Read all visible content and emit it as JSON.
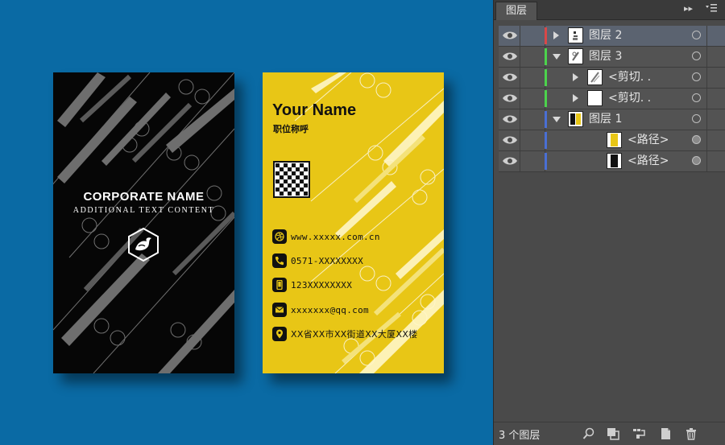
{
  "canvas": {
    "black_card": {
      "corporate_name": "CORPORATE NAME",
      "additional_text": "ADDITIONAL TEXT CONTENT"
    },
    "yellow_card": {
      "name": "Your Name",
      "position_title": "职位称呼",
      "website": "www.xxxxx.com.cn",
      "phone": "0571-XXXXXXXX",
      "mobile": "123XXXXXXXX",
      "email": "xxxxxxx@qq.com",
      "address": "XX省XX市XX街道XX大厦XX楼"
    },
    "colors": {
      "background": "#0a6aa4",
      "black_card": "#060606",
      "yellow_card": "#e8c616"
    }
  },
  "layers_panel": {
    "tab_label": "图层",
    "menu_glyph": "▸▸",
    "layers": [
      {
        "name": "图层 2",
        "color": "#d94848",
        "expand": "collapsed",
        "indent": 0,
        "thumb": "layer2",
        "target": "empty"
      },
      {
        "name": "图层 3",
        "color": "#4cd34c",
        "expand": "expanded",
        "indent": 0,
        "thumb": "layer3",
        "target": "empty"
      },
      {
        "name": "<剪切. .",
        "color": "#4cd34c",
        "expand": "collapsed",
        "indent": 1,
        "thumb": "clip1",
        "target": "empty"
      },
      {
        "name": "<剪切. .",
        "color": "#4cd34c",
        "expand": "collapsed",
        "indent": 1,
        "thumb": "clip2",
        "target": "empty"
      },
      {
        "name": "图层 1",
        "color": "#4a6fd4",
        "expand": "expanded",
        "indent": 0,
        "thumb": "layer1",
        "target": "empty"
      },
      {
        "name": "<路径>",
        "color": "#4a6fd4",
        "expand": "none",
        "indent": 2,
        "thumb": "path-yellow",
        "target": "filled"
      },
      {
        "name": "<路径>",
        "color": "#4a6fd4",
        "expand": "none",
        "indent": 2,
        "thumb": "path-black",
        "target": "filled"
      }
    ],
    "layer_count": "3 个图层",
    "bottom_icons": [
      "locate-icon",
      "clipping-mask-icon",
      "new-sublayer-icon",
      "new-layer-icon",
      "trash-icon"
    ]
  }
}
